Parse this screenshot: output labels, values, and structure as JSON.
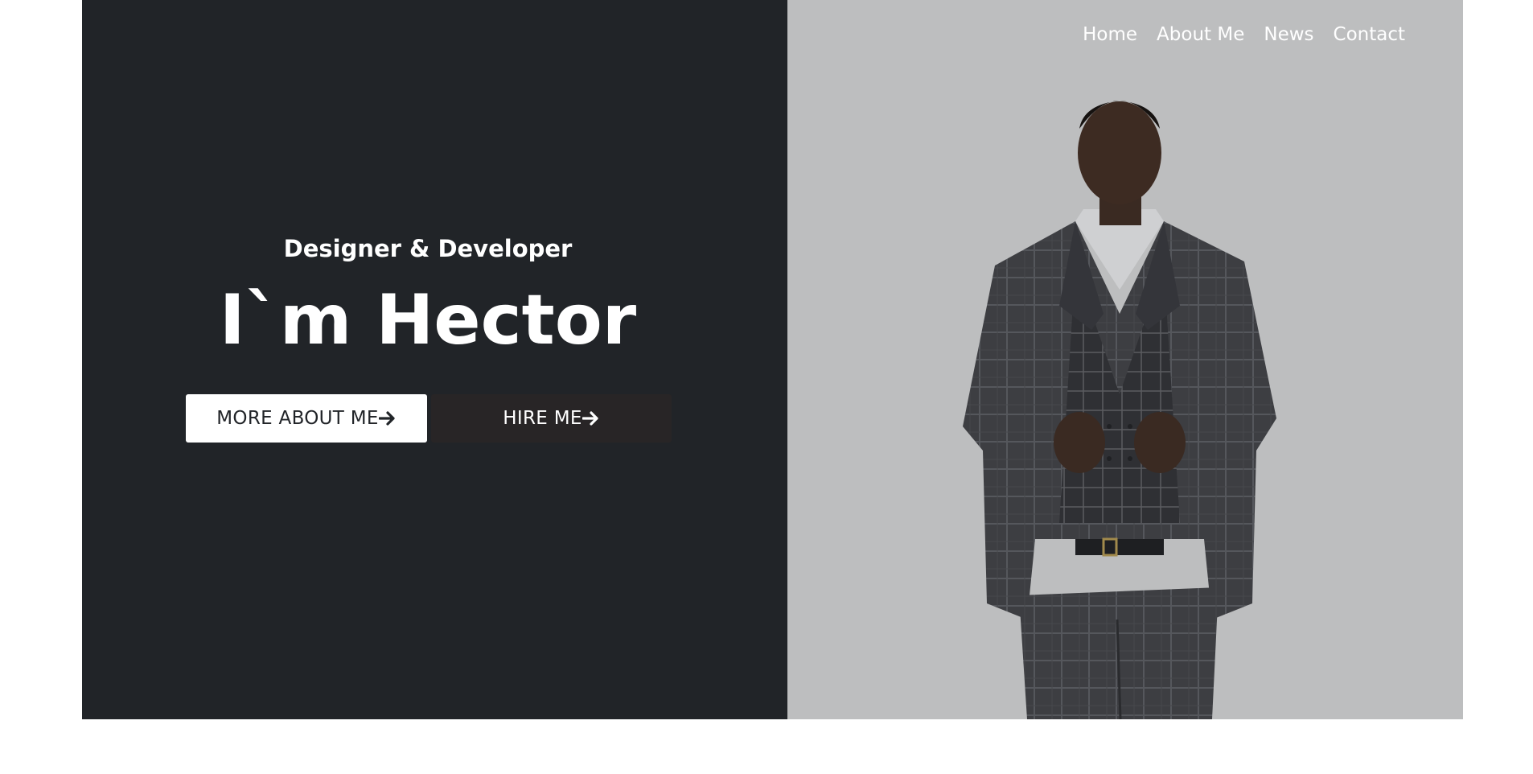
{
  "nav": {
    "items": [
      {
        "label": "Home"
      },
      {
        "label": "About Me"
      },
      {
        "label": "News"
      },
      {
        "label": "Contact"
      }
    ]
  },
  "hero": {
    "subtitle": "Designer & Developer",
    "title": "I`m Hector",
    "buttons": {
      "more_label": "MORE ABOUT ME",
      "hire_label": "HIRE ME"
    }
  },
  "colors": {
    "dark_panel": "#212428",
    "photo_bg": "#bdbebf",
    "hire_button": "#282526",
    "text_light": "#ffffff"
  },
  "icons": {
    "button_arrow": "arrow-right-icon"
  }
}
